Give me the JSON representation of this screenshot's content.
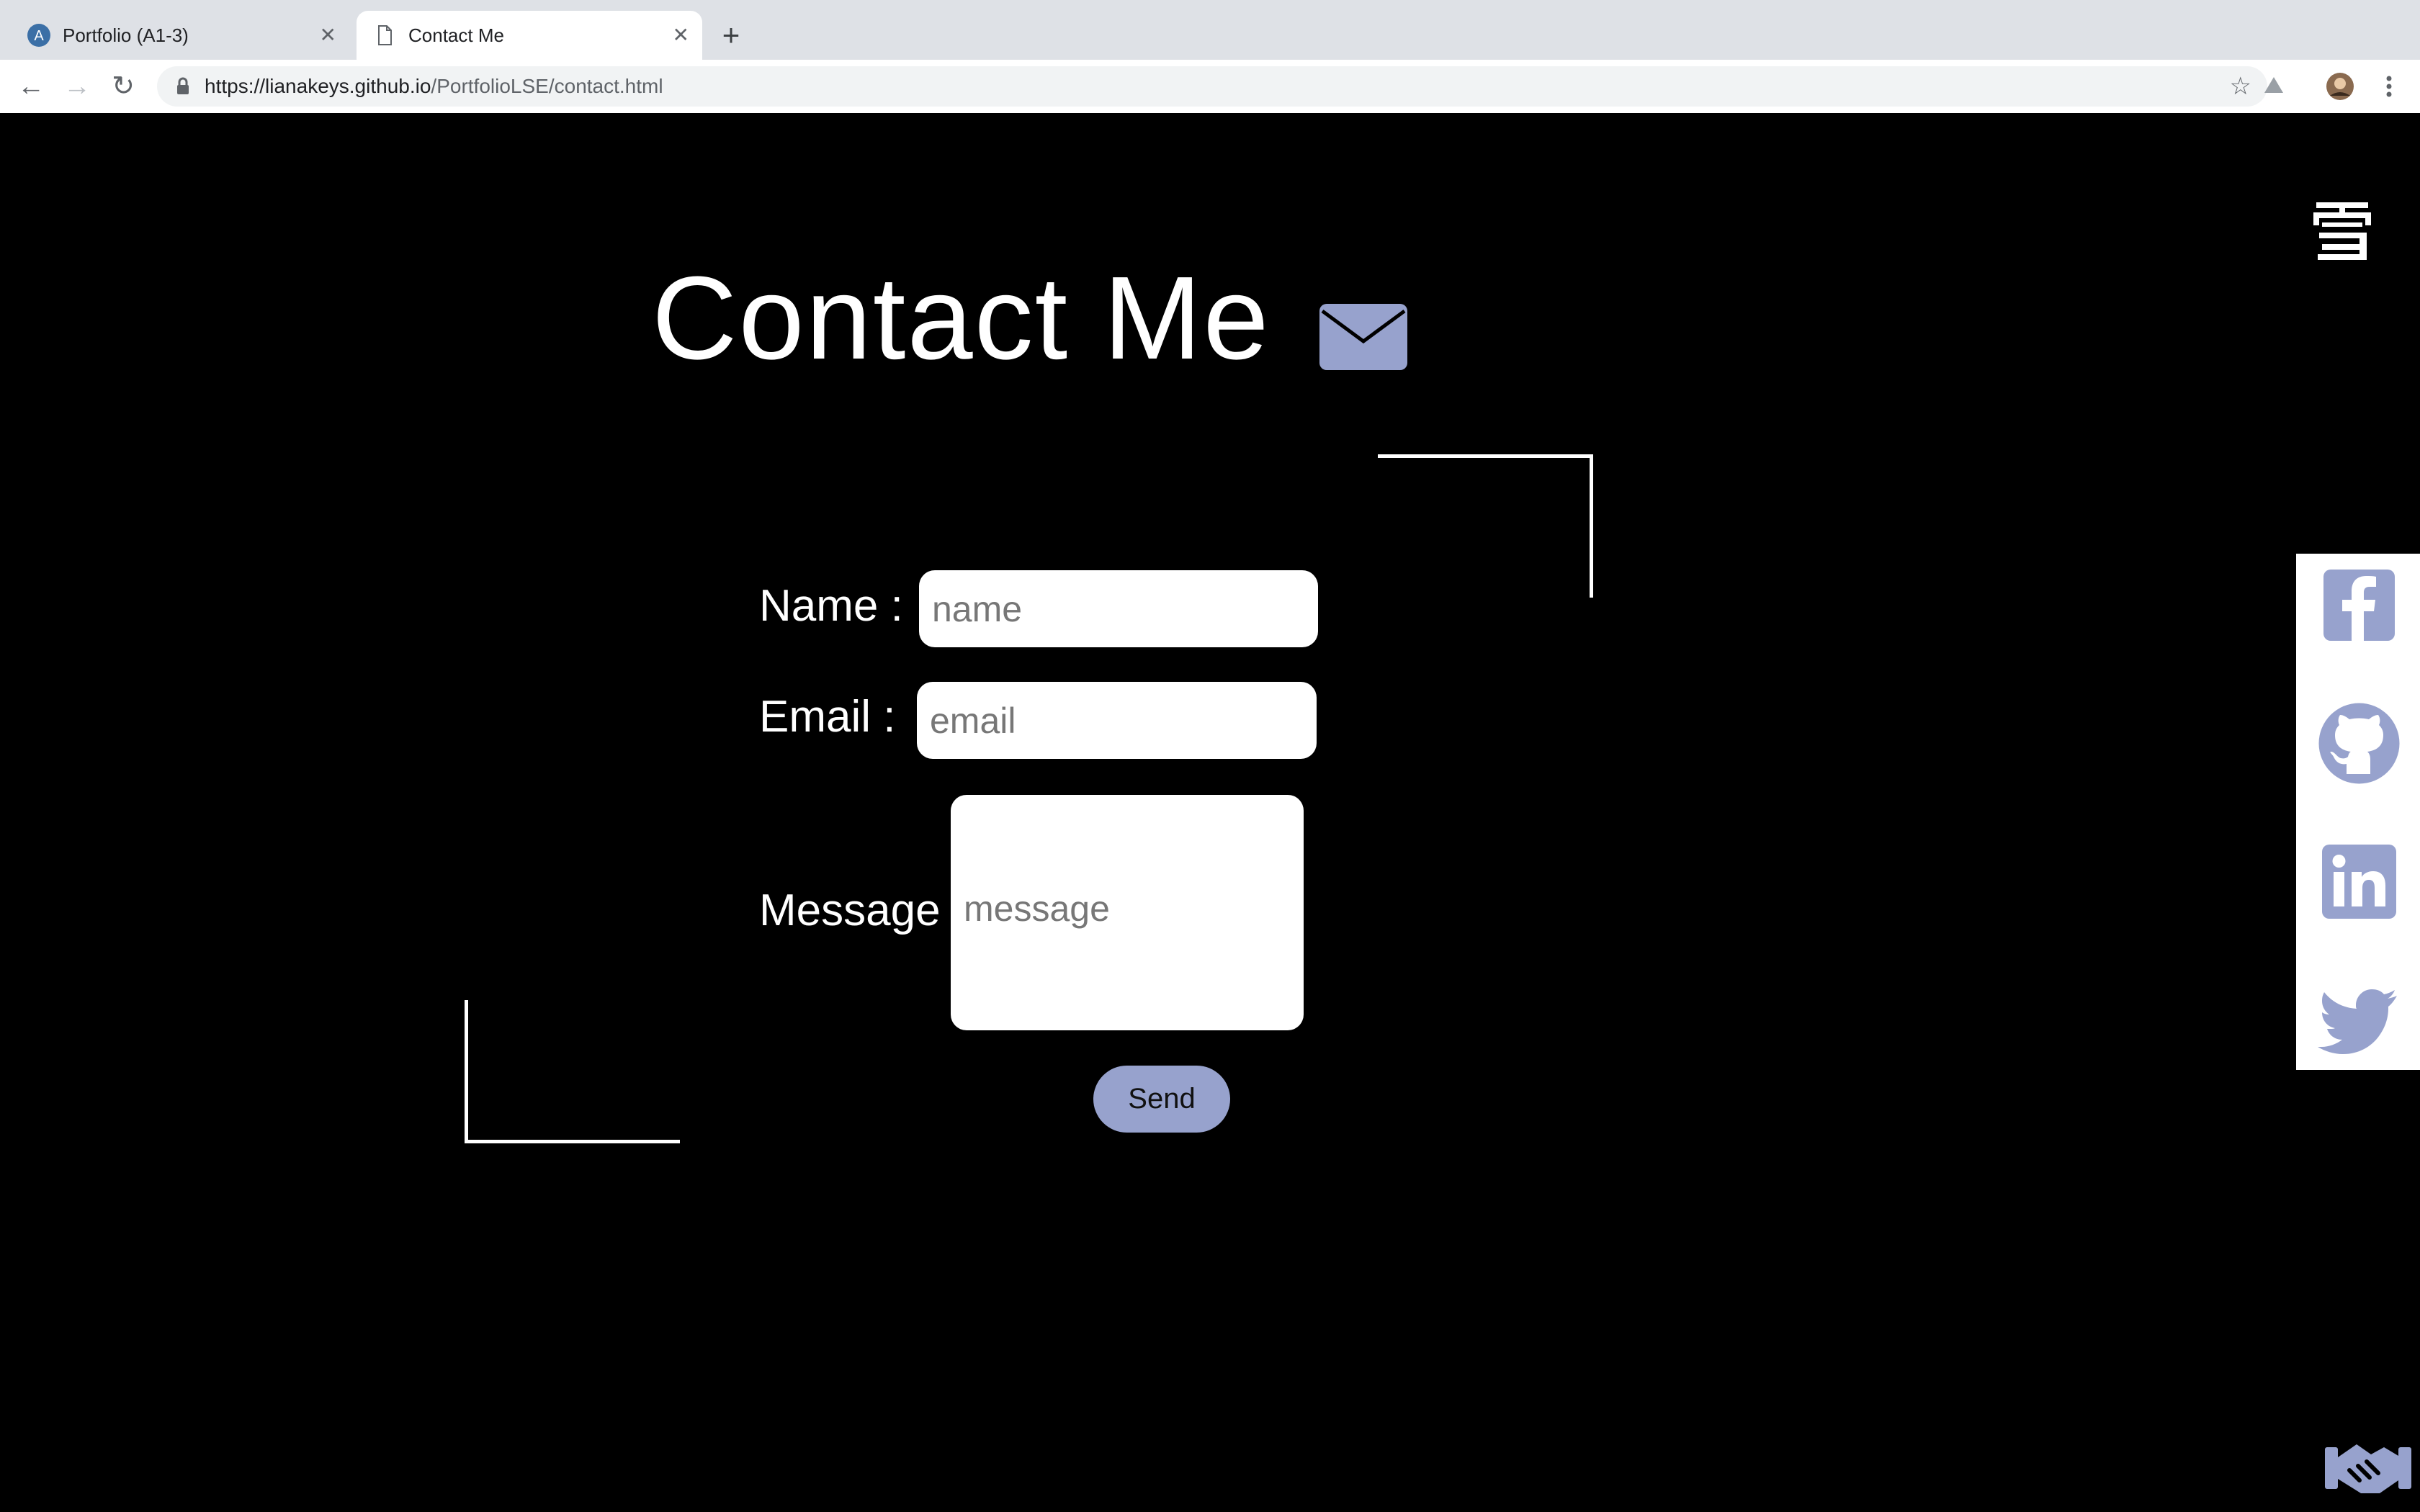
{
  "browser": {
    "tabs": [
      {
        "title": "Portfolio (A1-3)",
        "active": false
      },
      {
        "title": "Contact Me",
        "active": true
      }
    ],
    "url_host": "https://lianakeys.github.io",
    "url_path": "/PortfolioLSE/contact.html"
  },
  "page": {
    "heading": "Contact Me",
    "form": {
      "name_label": "Name :",
      "name_placeholder": "name",
      "email_label": "Email :",
      "email_placeholder": "email",
      "message_label": "Message :",
      "message_placeholder": "message",
      "send_label": "Send"
    },
    "social": [
      "facebook",
      "github",
      "linkedin",
      "twitter"
    ]
  },
  "colors": {
    "accent": "#97a2cd",
    "background": "#000000"
  }
}
